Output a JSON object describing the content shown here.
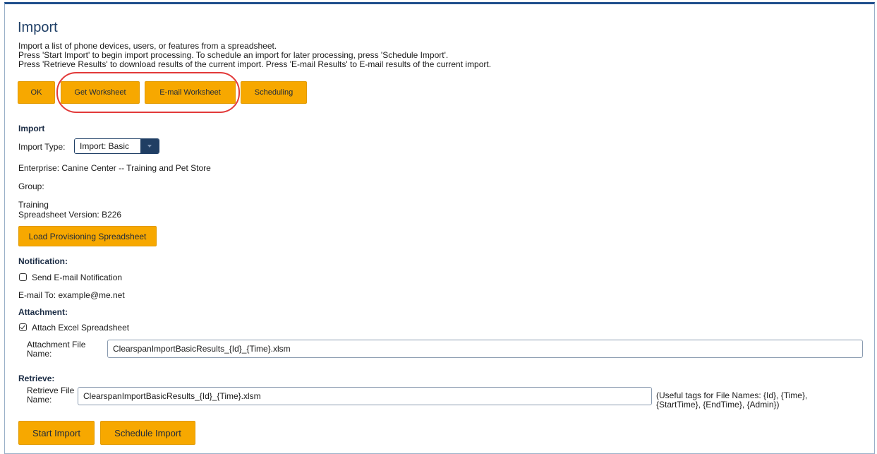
{
  "page": {
    "title": "Import",
    "intro_lines": [
      "Import a list of phone devices, users, or features from a spreadsheet.",
      "Press 'Start Import' to begin import processing.  To schedule an import for later processing, press 'Schedule Import'.",
      "Press 'Retrieve Results' to download results of the current import.  Press 'E-mail Results' to E-mail results of the current import."
    ]
  },
  "toolbar": {
    "ok_label": "OK",
    "get_worksheet_label": "Get Worksheet",
    "email_worksheet_label": "E-mail Worksheet",
    "scheduling_label": "Scheduling"
  },
  "import_section": {
    "heading": "Import",
    "import_type_label": "Import Type:",
    "import_type_value": "Import: Basic",
    "enterprise_text": "Enterprise:  Canine Center -- Training and Pet Store",
    "group_text": "Group:",
    "training_text": "Training",
    "spreadsheet_version_text": "Spreadsheet Version:  B226",
    "load_button_label": "Load Provisioning Spreadsheet"
  },
  "notification": {
    "heading": "Notification:",
    "send_email_label": "Send E-mail Notification",
    "send_email_checked": false,
    "email_to_text": "E-mail To:  example@me.net"
  },
  "attachment": {
    "heading": "Attachment:",
    "attach_label": "Attach Excel Spreadsheet",
    "attach_checked": true,
    "file_name_label": "Attachment File Name:",
    "file_name_value": "ClearspanImportBasicResults_{Id}_{Time}.xlsm"
  },
  "retrieve": {
    "heading": "Retrieve:",
    "file_name_label": "Retrieve File Name:",
    "file_name_value": "ClearspanImportBasicResults_{Id}_{Time}.xlsm",
    "tags_help_line1": "(Useful tags for File Names: {Id}, {Time},",
    "tags_help_line2": "{StartTime}, {EndTime}, {Admin})"
  },
  "actions": {
    "start_import_label": "Start Import",
    "schedule_import_label": "Schedule Import"
  },
  "colors": {
    "button": "#f7a800",
    "highlight": "#e23a3a",
    "select_arrow_bg": "#203e63",
    "title": "#1f3f66"
  }
}
